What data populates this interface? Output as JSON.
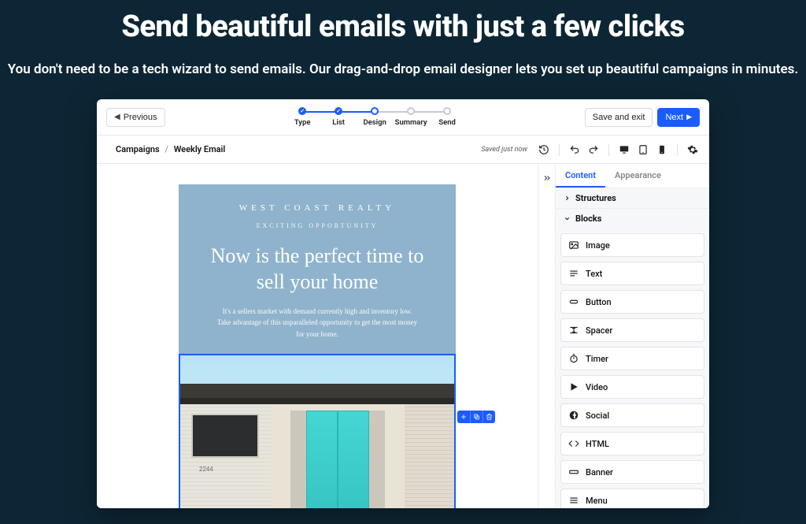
{
  "hero": {
    "title": "Send beautiful emails with just a few clicks",
    "subtitle": "You don't need to be a tech wizard to send emails. Our drag-and-drop email designer lets you set up beautiful campaigns in minutes."
  },
  "topbar": {
    "previous": "Previous",
    "save_exit": "Save and exit",
    "next": "Next",
    "steps": [
      "Type",
      "List",
      "Design",
      "Summary",
      "Send"
    ],
    "active_step_index": 2
  },
  "breadcrumb": {
    "root": "Campaigns",
    "current": "Weekly Email",
    "saved_status": "Saved just now"
  },
  "sidebar": {
    "tabs": {
      "content": "Content",
      "appearance": "Appearance"
    },
    "sections": {
      "structures": "Structures",
      "blocks": "Blocks"
    },
    "blocks": [
      {
        "id": "image",
        "label": "Image"
      },
      {
        "id": "text",
        "label": "Text"
      },
      {
        "id": "button",
        "label": "Button"
      },
      {
        "id": "spacer",
        "label": "Spacer"
      },
      {
        "id": "timer",
        "label": "Timer"
      },
      {
        "id": "video",
        "label": "Video"
      },
      {
        "id": "social",
        "label": "Social"
      },
      {
        "id": "html",
        "label": "HTML"
      },
      {
        "id": "banner",
        "label": "Banner"
      },
      {
        "id": "menu",
        "label": "Menu"
      }
    ]
  },
  "email_preview": {
    "brand": "WEST COAST REALTY",
    "eyebrow": "EXCITING OPPORTUNITY",
    "headline": "Now is the perfect time to sell your home",
    "body": "It's a sellers market with demand currently high and inventory low. Take advantage of this unparalleled opportunity to get the most money for your home.",
    "house_number": "2244"
  },
  "colors": {
    "accent": "#1a5cff",
    "page_bg": "#0d2635",
    "email_bg": "#8fb3cc"
  }
}
